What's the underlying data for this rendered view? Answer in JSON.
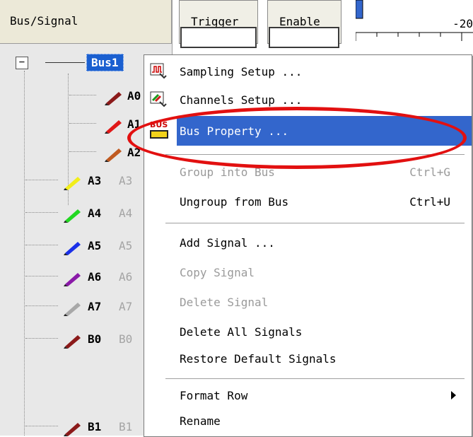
{
  "header": {
    "tree_title": "Bus/Signal",
    "trigger_label": "Trigger",
    "enable_label": "Enable",
    "ruler_tick_label": "-20"
  },
  "tree": {
    "bus": {
      "label": "Bus1",
      "expand_toggle": "−"
    },
    "bus_children": [
      {
        "name": "A0",
        "color": "#8b1a1a"
      },
      {
        "name": "A1",
        "color": "#e01818"
      },
      {
        "name": "A2",
        "color": "#c05a20"
      }
    ],
    "signals": [
      {
        "name": "A3",
        "alias": "A3",
        "color": "#f2ee1a"
      },
      {
        "name": "A4",
        "alias": "A4",
        "color": "#22d822"
      },
      {
        "name": "A5",
        "alias": "A5",
        "color": "#1a30e8"
      },
      {
        "name": "A6",
        "alias": "A6",
        "color": "#8a1aa8"
      },
      {
        "name": "A7",
        "alias": "A7",
        "color": "#a8a8a8"
      },
      {
        "name": "B0",
        "alias": "B0",
        "color": "#8b1a1a"
      },
      {
        "name": "B1",
        "alias": "B1",
        "color": "#8b1a1a"
      }
    ]
  },
  "context_menu": {
    "items": [
      {
        "label": "Sampling Setup ...",
        "shortcut": "",
        "icon": "sampling-icon",
        "state": "enabled"
      },
      {
        "label": "Channels Setup ...",
        "shortcut": "",
        "icon": "channels-icon",
        "state": "enabled"
      },
      {
        "label": "Bus Property ...",
        "shortcut": "",
        "icon": "bus-icon",
        "state": "highlighted"
      },
      {
        "label": "Group into Bus",
        "shortcut": "Ctrl+G",
        "state": "disabled"
      },
      {
        "label": "Ungroup from Bus",
        "shortcut": "Ctrl+U",
        "state": "enabled"
      },
      {
        "label": "Add Signal ...",
        "shortcut": "",
        "state": "enabled"
      },
      {
        "label": "Copy Signal",
        "shortcut": "",
        "state": "disabled"
      },
      {
        "label": "Delete Signal",
        "shortcut": "",
        "state": "disabled"
      },
      {
        "label": "Delete All Signals",
        "shortcut": "",
        "state": "enabled"
      },
      {
        "label": "Restore Default Signals",
        "shortcut": "",
        "state": "enabled"
      },
      {
        "label": "Format Row",
        "shortcut": "",
        "state": "enabled",
        "submenu": true
      },
      {
        "label": "Rename",
        "shortcut": "",
        "state": "enabled"
      }
    ],
    "bus_icon_text": "BUS"
  },
  "colors": {
    "highlight": "#3366cc",
    "annotation_oval": "#e21010",
    "disabled_text": "#9a9a9a"
  }
}
